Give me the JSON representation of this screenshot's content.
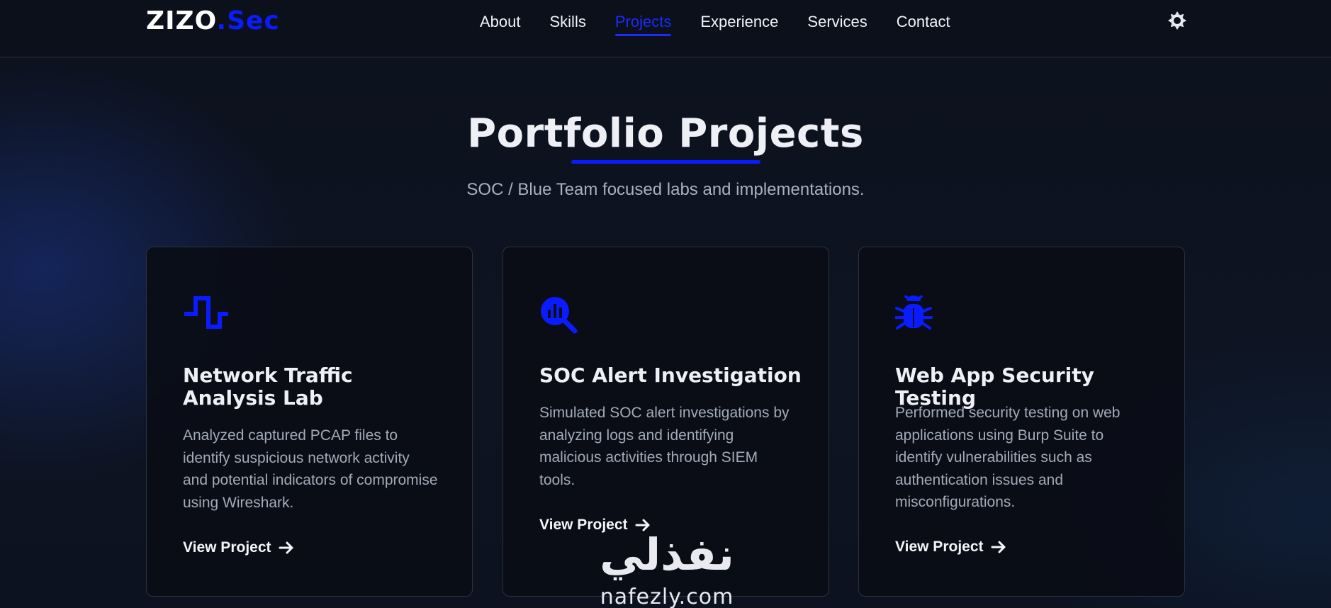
{
  "nav": {
    "logo_main": "ZIZO",
    "logo_accent": ".Sec",
    "links": [
      {
        "label": "About",
        "active": false
      },
      {
        "label": "Skills",
        "active": false
      },
      {
        "label": "Projects",
        "active": true
      },
      {
        "label": "Experience",
        "active": false
      },
      {
        "label": "Services",
        "active": false
      },
      {
        "label": "Contact",
        "active": false
      }
    ],
    "theme_toggle_icon": "sun-icon"
  },
  "hero": {
    "title": "Portfolio Projects",
    "subtitle": "SOC / Blue Team focused labs and implementations."
  },
  "projects": [
    {
      "icon": "network-waveform-icon",
      "title": "Network Traffic Analysis Lab",
      "description": "Analyzed captured PCAP files to identify suspicious network activity and potential indicators of compromise using Wireshark.",
      "link_label": "View Project"
    },
    {
      "icon": "search-chart-icon",
      "title": "SOC Alert Investigation",
      "description": "Simulated SOC alert investigations by analyzing logs and identifying malicious activities through SIEM tools.",
      "link_label": "View Project"
    },
    {
      "icon": "bug-icon",
      "title": "Web App Security Testing",
      "description": "Performed security testing on web applications using Burp Suite to identify vulnerabilities such as authentication issues and misconfigurations.",
      "link_label": "View Project"
    }
  ],
  "watermark": {
    "arabic": "نفذلي",
    "latin": "nafezly.com"
  },
  "colors": {
    "accent": "#0a1cff",
    "background": "#0b0f19",
    "card_border": "#2b3140",
    "text_muted": "#a3aab8"
  }
}
